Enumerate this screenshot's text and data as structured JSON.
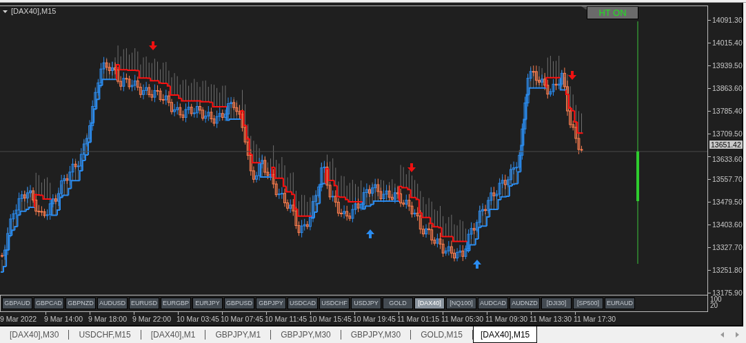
{
  "chart": {
    "title": "[DAX40],M15",
    "ht_button": "HT ON",
    "current_price": "13651.42",
    "price_labels": [
      "14091.30",
      "14015.40",
      "13939.50",
      "13863.60",
      "13785.40",
      "13709.50",
      "13633.60",
      "13557.70",
      "13479.50",
      "13403.60",
      "13327.70",
      "13251.80",
      "13175.90"
    ],
    "time_labels": [
      "9 Mar 2022",
      "9 Mar 14:00",
      "9 Mar 18:00",
      "9 Mar 22:00",
      "10 Mar 03:45",
      "10 Mar 07:45",
      "10 Mar 11:45",
      "10 Mar 15:45",
      "10 Mar 19:45",
      "11 Mar 01:15",
      "11 Mar 05:30",
      "11 Mar 09:30",
      "11 Mar 13:30",
      "11 Mar 17:30"
    ]
  },
  "symbol_buttons": [
    {
      "label": "GBPAUD",
      "selected": false
    },
    {
      "label": "GBPCAD",
      "selected": false
    },
    {
      "label": "GBPNZD",
      "selected": false
    },
    {
      "label": "AUDUSD",
      "selected": false
    },
    {
      "label": "EURUSD",
      "selected": false
    },
    {
      "label": "EURGBP",
      "selected": false
    },
    {
      "label": "EURJPY",
      "selected": false
    },
    {
      "label": "GBPUSD",
      "selected": false
    },
    {
      "label": "GBPJPY",
      "selected": false
    },
    {
      "label": "USDCAD",
      "selected": false
    },
    {
      "label": "USDCHF",
      "selected": false
    },
    {
      "label": "USDJPY",
      "selected": false
    },
    {
      "label": "GOLD",
      "selected": false
    },
    {
      "label": "[DAX40]",
      "selected": true
    },
    {
      "label": "[NQ100]",
      "selected": false
    },
    {
      "label": "AUDCAD",
      "selected": false
    },
    {
      "label": "AUDNZD",
      "selected": false
    },
    {
      "label": "[DJI30]",
      "selected": false
    },
    {
      "label": "[SP500]",
      "selected": false
    },
    {
      "label": "EURAUD",
      "selected": false
    }
  ],
  "subwindow_labels": [
    "100",
    "20"
  ],
  "tabs": [
    {
      "label": "[DAX40],M30",
      "selected": false
    },
    {
      "label": "USDCHF,M15",
      "selected": false
    },
    {
      "label": "[DAX40],M1",
      "selected": false
    },
    {
      "label": "GBPJPY,M1",
      "selected": false
    },
    {
      "label": "GBPJPY,M30",
      "selected": false
    },
    {
      "label": "GBPJPY,M30",
      "selected": false
    },
    {
      "label": "GOLD,M15",
      "selected": false
    },
    {
      "label": "[DAX40],M15",
      "selected": true
    }
  ]
}
